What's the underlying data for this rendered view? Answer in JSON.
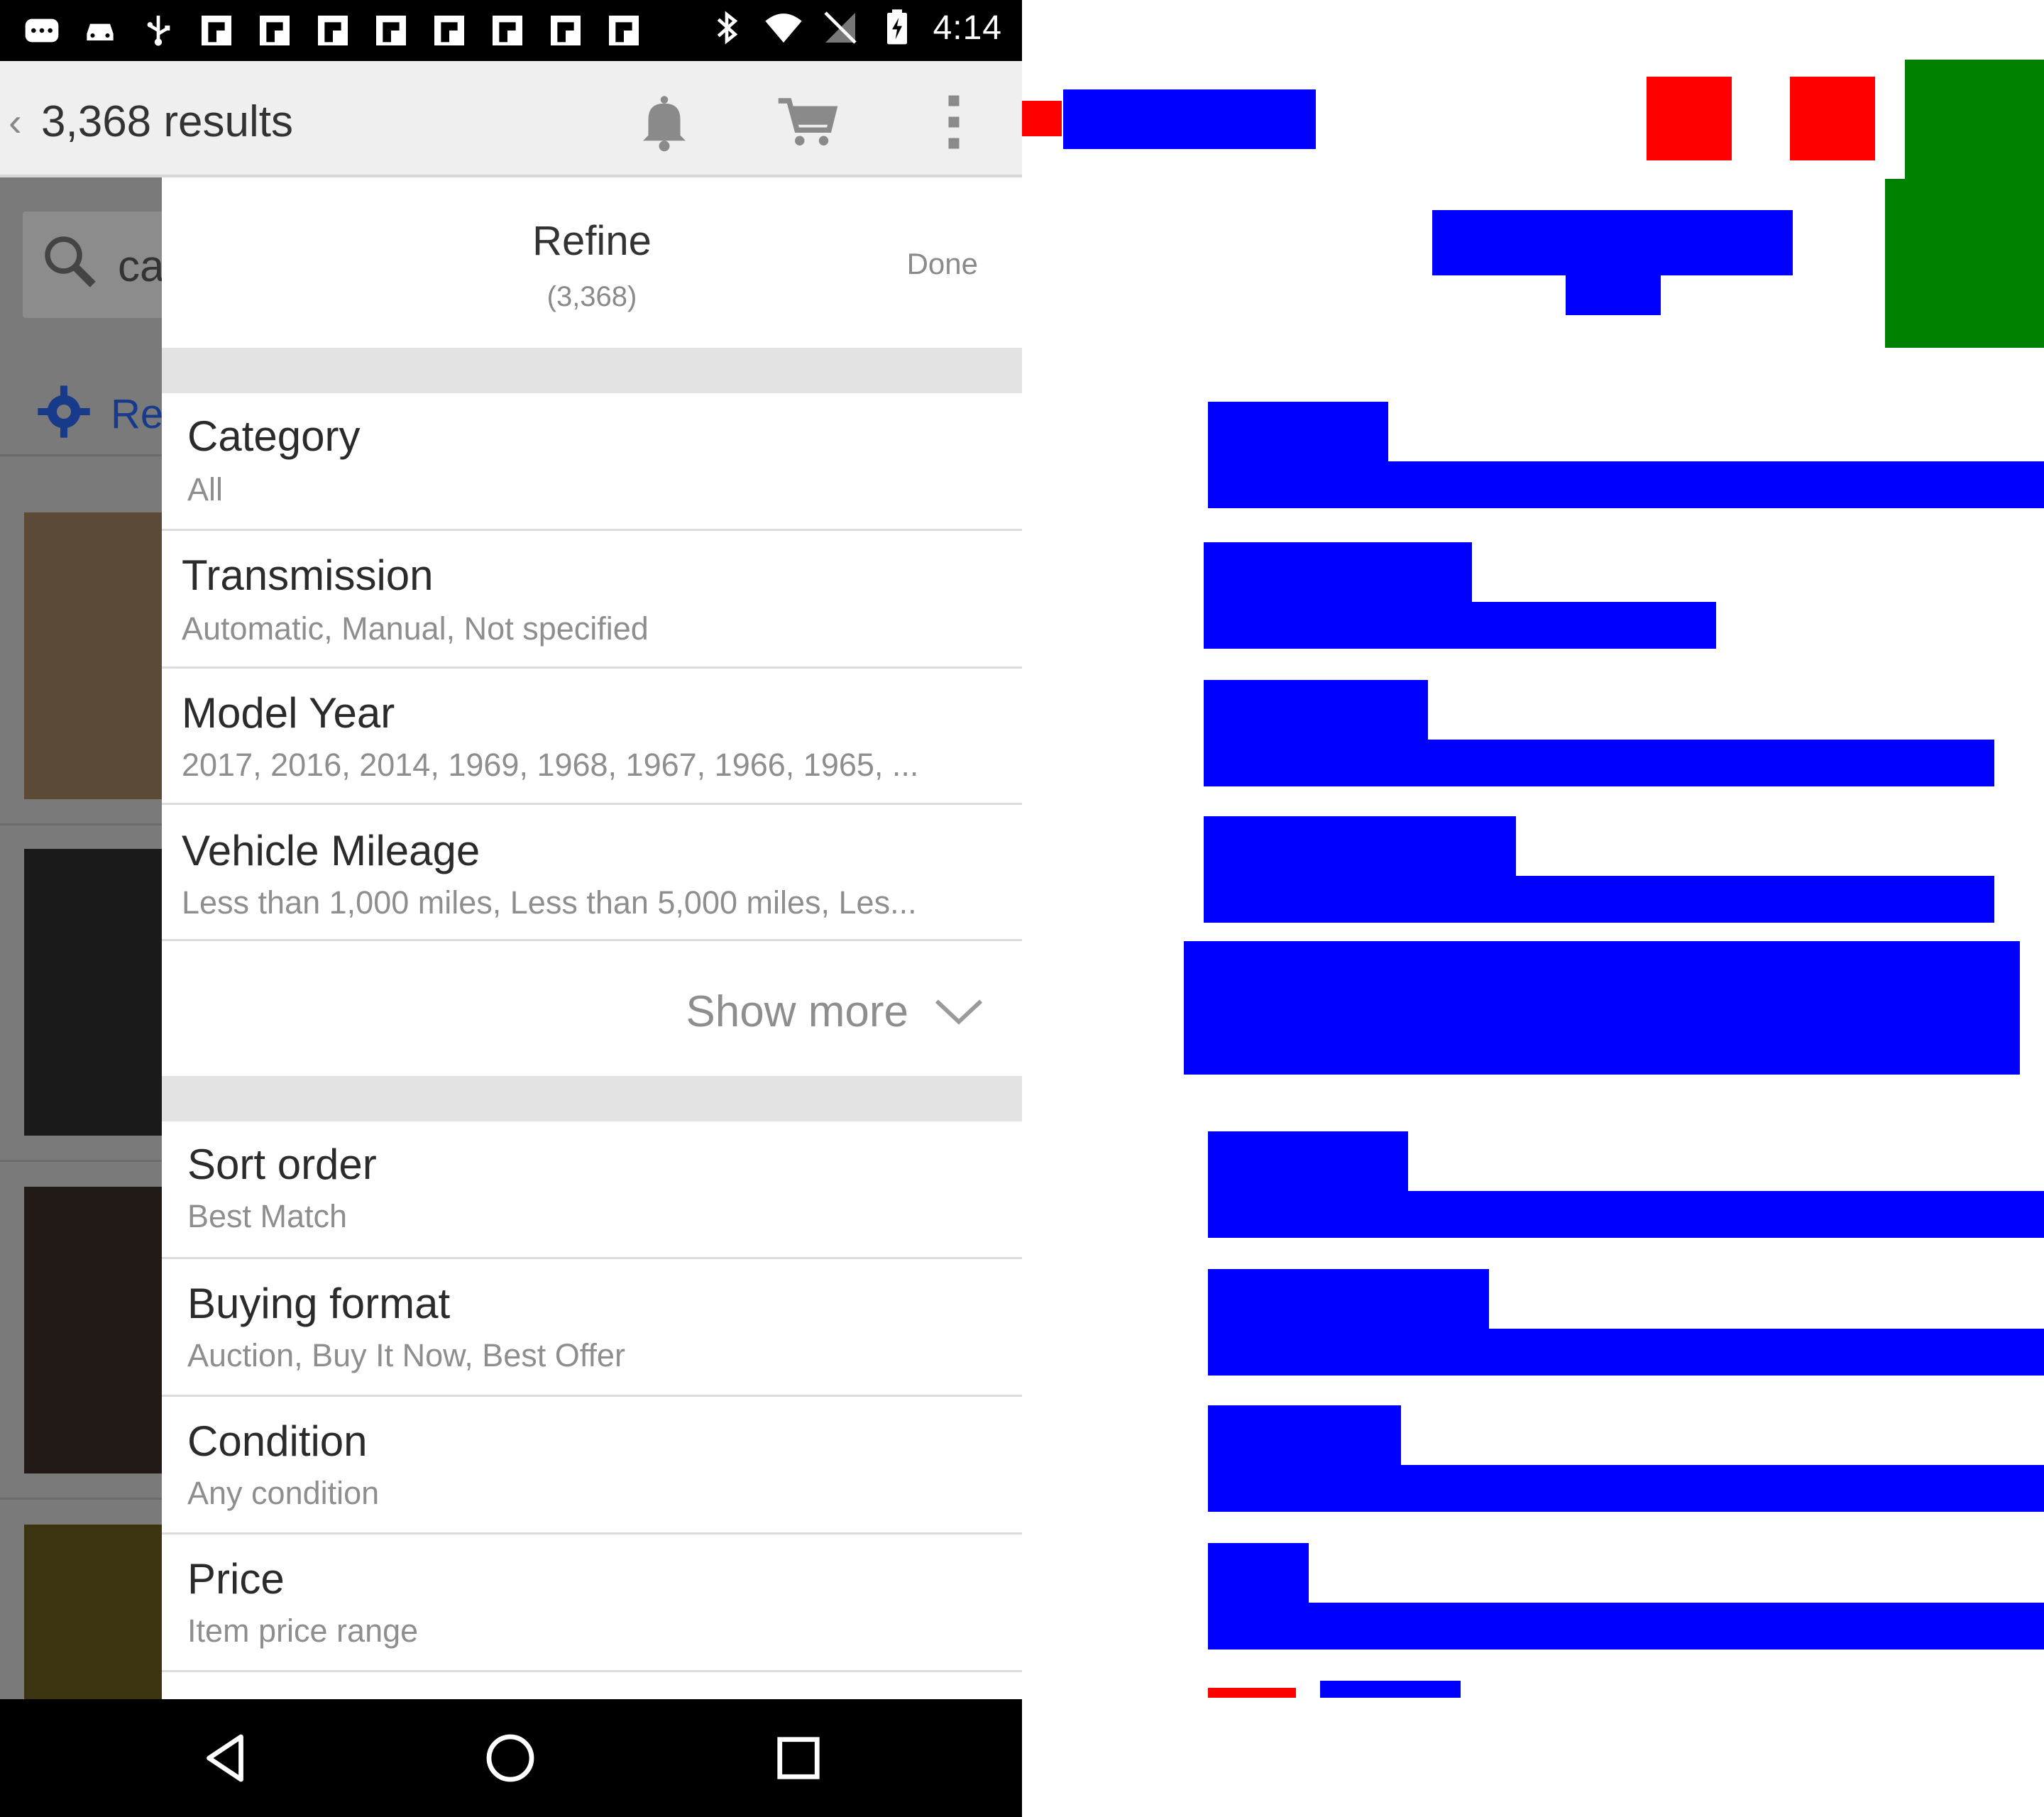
{
  "status_bar": {
    "time": "4:14",
    "left_icons": [
      "message-icon",
      "car-icon",
      "usb-icon",
      "flipboard-icon",
      "flipboard-icon",
      "flipboard-icon",
      "flipboard-icon",
      "flipboard-icon",
      "flipboard-icon",
      "flipboard-icon",
      "flipboard-icon"
    ],
    "right_icons": [
      "bluetooth-icon",
      "wifi-icon",
      "no-signal-icon",
      "battery-charging-icon"
    ]
  },
  "app_bar": {
    "title": "3,368 results",
    "actions": [
      "bell-icon",
      "cart-icon",
      "overflow-menu-icon"
    ]
  },
  "background_list": {
    "search_text": "ca",
    "refine_text": "Re"
  },
  "refine_drawer": {
    "title": "Refine",
    "count": "(3,368)",
    "done_label": "Done",
    "filters_group_1": [
      {
        "label": "Category",
        "value": "All"
      },
      {
        "label": "Transmission",
        "value": "Automatic, Manual, Not specified"
      },
      {
        "label": "Model Year",
        "value": "2017, 2016, 2014, 1969, 1968, 1967, 1966, 1965, ..."
      },
      {
        "label": "Vehicle Mileage",
        "value": "Less than 1,000 miles, Less than 5,000 miles, Les..."
      }
    ],
    "show_more_label": "Show more",
    "filters_group_2": [
      {
        "label": "Sort order",
        "value": "Best Match"
      },
      {
        "label": "Buying format",
        "value": "Auction, Buy It Now, Best Offer"
      },
      {
        "label": "Condition",
        "value": "Any condition"
      },
      {
        "label": "Price",
        "value": "Item price range"
      }
    ]
  },
  "nav_bar": {
    "buttons": [
      "back-icon",
      "home-icon",
      "recents-icon"
    ]
  },
  "overlay_colors": {
    "interactive": "#ff0000",
    "text": "#0000ff",
    "image": "#008000"
  }
}
